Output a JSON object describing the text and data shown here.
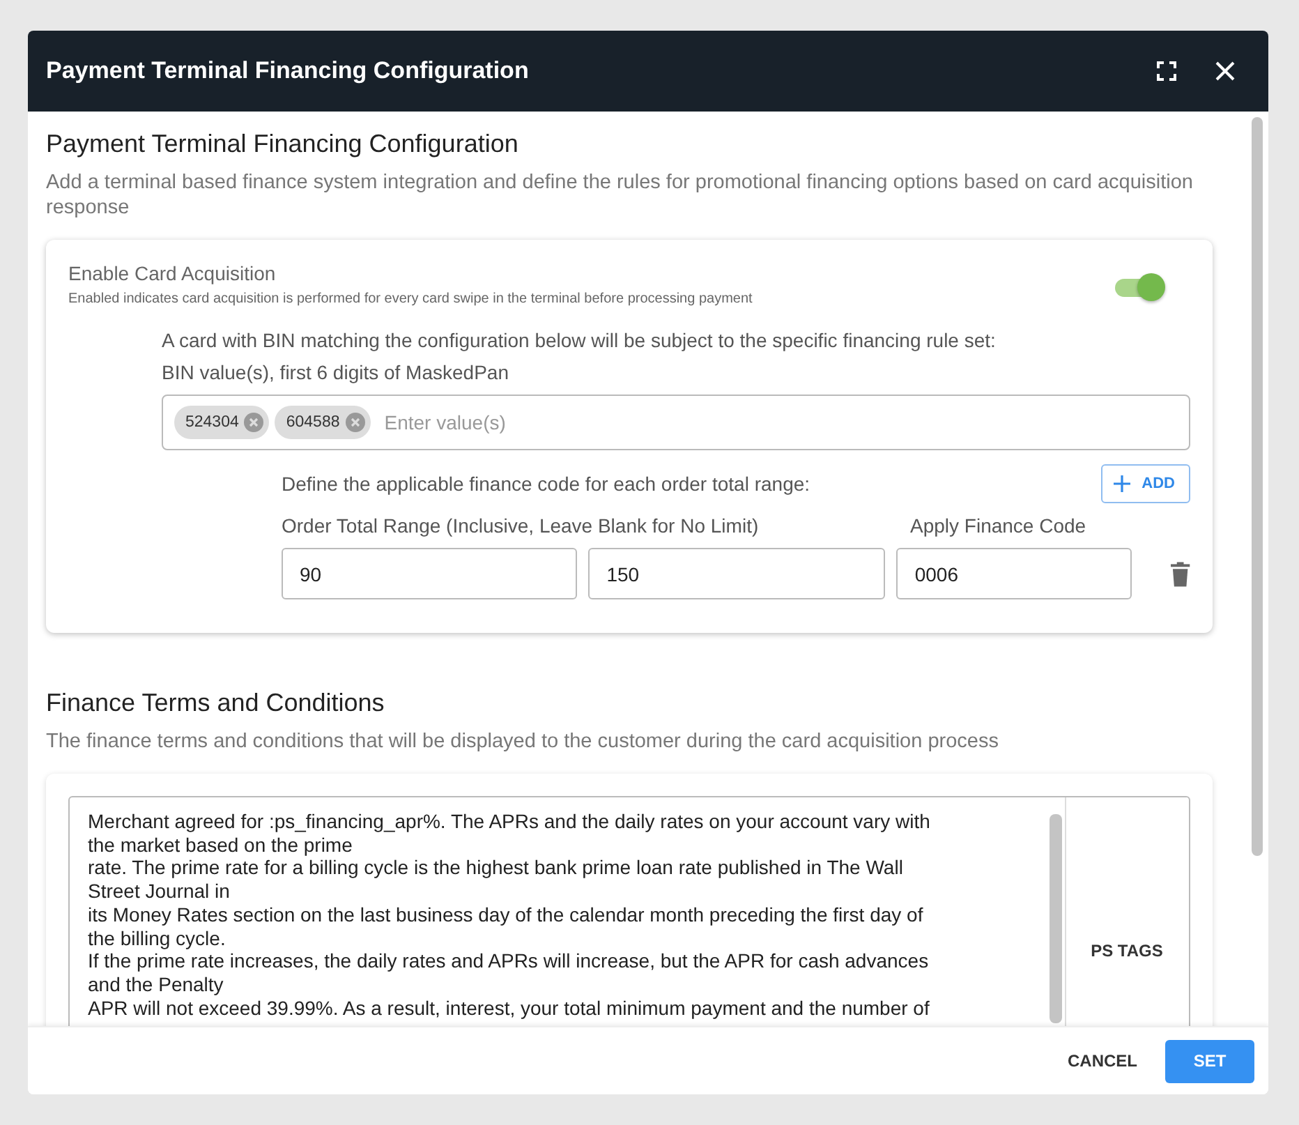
{
  "dialog": {
    "title": "Payment Terminal Financing Configuration"
  },
  "configuration": {
    "heading": "Payment Terminal Financing Configuration",
    "description": "Add a terminal based finance system integration and define the rules for promotional financing options based on card acquisition response"
  },
  "card_acquisition": {
    "label": "Enable Card Acquisition",
    "hint": "Enabled indicates card acquisition is performed for every card swipe in the terminal before processing payment",
    "enabled": true,
    "bin_prompt": "A card with BIN matching the configuration below will be subject to the specific financing rule set:",
    "bin_label": "BIN value(s), first 6 digits of MaskedPan",
    "bin_values": [
      "524304",
      "604588"
    ],
    "bin_placeholder": "Enter value(s)",
    "range_prompt": "Define the applicable finance code for each order total range:",
    "add_button": "ADD",
    "range_label": "Order Total Range (Inclusive, Leave Blank for No Limit)",
    "code_label": "Apply Finance Code",
    "ranges": [
      {
        "min": "90",
        "max": "150",
        "code": "0006"
      }
    ]
  },
  "terms": {
    "heading": "Finance Terms and Conditions",
    "description": "The finance terms and conditions that will be displayed to the customer during the card acquisition process",
    "text_lines": [
      "Merchant agreed for :ps_financing_apr%. The APRs and the daily rates on your account vary with",
      "the market based on the prime",
      "rate. The prime rate for a billing cycle is the highest bank prime loan rate published in The Wall",
      "Street Journal in",
      "its Money Rates section on the last business day of the calendar month preceding the first day of",
      "the billing cycle.",
      "If the prime rate increases, the daily rates and APRs will increase, but the APR for cash advances",
      "and the Penalty",
      "APR will not exceed 39.99%. As a result, interest, your total minimum payment and the number of"
    ],
    "tags_button": "PS TAGS"
  },
  "buttons": {
    "cancel": "CANCEL",
    "set": "SET"
  }
}
